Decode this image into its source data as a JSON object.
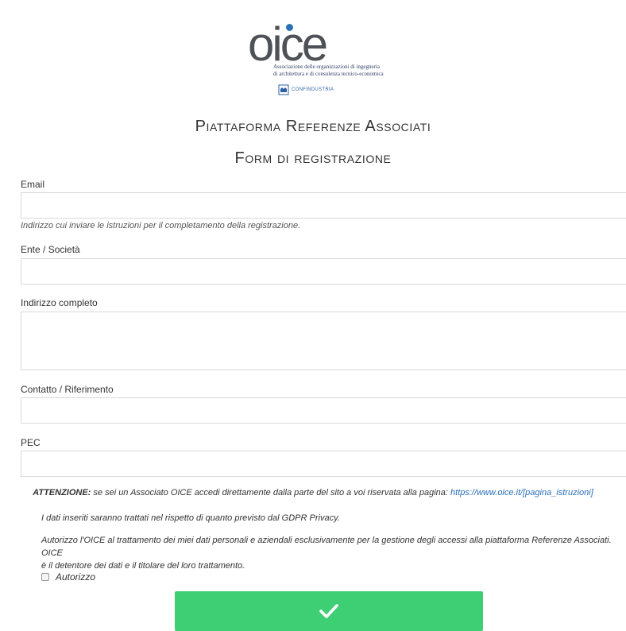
{
  "logo": {
    "wordmark": "oice",
    "subtitle_line1": "Associazione delle organizzazioni di ingegneria",
    "subtitle_line2": "di architettura e di consulenza tecnico-economica",
    "confindustria": "CONFINDUSTRIA"
  },
  "page": {
    "title": "Piattaforma Referenze Associati",
    "subtitle": "Form di registrazione"
  },
  "form": {
    "email_label": "Email",
    "email_value": "",
    "email_help": "Indirizzo cui inviare le istruzioni per il completamento della registrazione.",
    "company_label": "Ente / Società",
    "company_value": "",
    "address_label": "Indirizzo completo",
    "address_value": "",
    "contact_label": "Contatto / Riferimento",
    "contact_value": "",
    "pec_label": "PEC",
    "pec_value": ""
  },
  "notice": {
    "strong": "ATTENZIONE:",
    "text": " se sei un Associato OICE accedi direttamente dalla parte del sito a voi riservata alla pagina: ",
    "link": "https://www.oice.it/[pagina_istruzioni]"
  },
  "privacy": {
    "gdpr": "I dati inseriti saranno trattati nel rispetto di quanto previsto dal GDPR Privacy.",
    "consent_line1": "Autorizzo l'OICE al trattamento dei miei dati personali e aziendali esclusivamente per la gestione degli accessi alla piattaforma Referenze Associati. OICE",
    "consent_line2": "è il detentore dei dati e il titolare del loro trattamento.",
    "checkbox_label": "Autorizzo",
    "checkbox_checked": false
  },
  "colors": {
    "submit_bg": "#3ecf74",
    "logo_dot": "#2a72b5",
    "link": "#2a6ebb"
  },
  "submit": {
    "icon": "checkmark-icon"
  }
}
